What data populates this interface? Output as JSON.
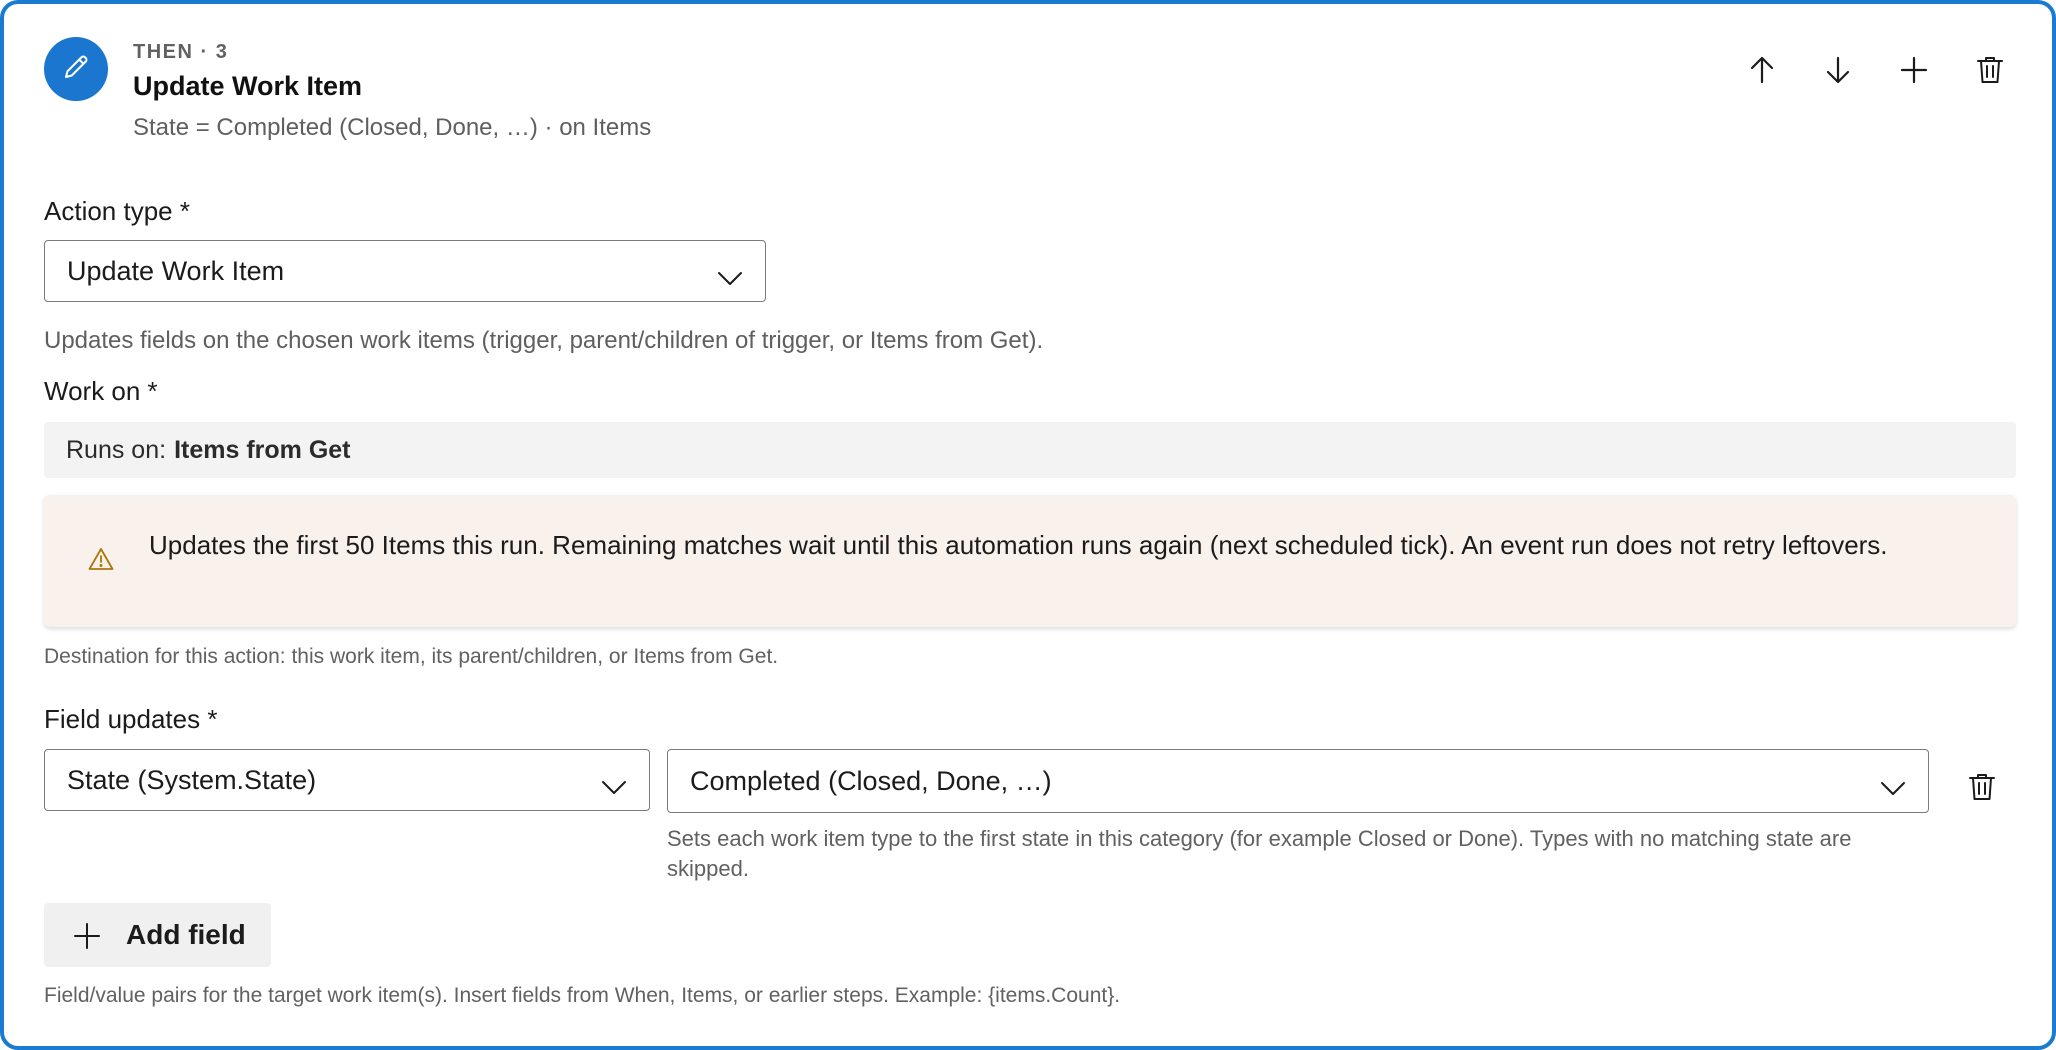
{
  "header": {
    "eyebrow": "THEN · 3",
    "title": "Update Work Item",
    "subtitle": "State = Completed (Closed, Done, …) · on Items",
    "icon": "pencil-icon",
    "accent_color": "#1a7bd1",
    "toolbar": [
      "move-up-icon",
      "move-down-icon",
      "add-icon",
      "delete-icon"
    ]
  },
  "action_type": {
    "label": "Action type *",
    "value": "Update Work Item",
    "help": "Updates fields on the chosen work items (trigger, parent/children of trigger, or Items from Get)."
  },
  "work_on": {
    "label": "Work on *",
    "runs_on_prefix": "Runs on:",
    "runs_on_value": "Items from Get",
    "warning": "Updates the first 50 Items this run. Remaining matches wait until this automation runs again (next scheduled tick). An event run does not retry leftovers.",
    "warning_color": "#f9f1ec",
    "help": "Destination for this action: this work item, its parent/children, or Items from Get."
  },
  "field_updates": {
    "label": "Field updates *",
    "rows": [
      {
        "field": "State (System.State)",
        "value": "Completed (Closed, Done, …)",
        "value_help": "Sets each work item type to the first state in this category (for example Closed or Done). Types with no matching state are skipped."
      }
    ],
    "add_label": "Add field",
    "help": "Field/value pairs for the target work item(s). Insert fields from When, Items, or earlier steps. Example: {items.Count}."
  }
}
